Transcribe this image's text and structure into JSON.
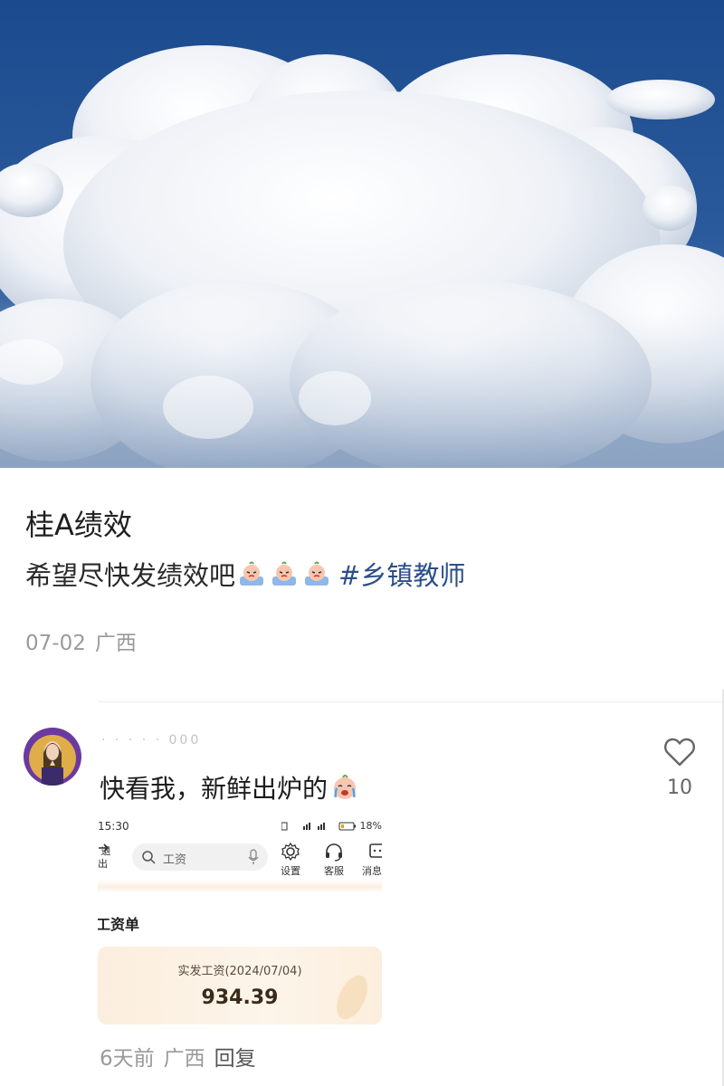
{
  "post": {
    "title": "桂A绩效",
    "body": "希望尽快发绩效吧",
    "hashtag": "#乡镇教师",
    "date": "07-02",
    "location": "广西"
  },
  "comment": {
    "username": "· · · · · 000",
    "text": "快看我，新鲜出炉的",
    "likes": "10",
    "time": "6天前",
    "location": "广西",
    "reply_label": "回复",
    "screenshot": {
      "status_time": "15:30",
      "status_right": "18%",
      "exit_label": "退出",
      "search_placeholder": "工资",
      "settings_label": "设置",
      "service_label": "客服",
      "message_label": "消息",
      "section_title": "工资单",
      "pay_label": "实发工资(2024/07/04)",
      "pay_amount": "934.39"
    }
  },
  "colors": {
    "hashtag": "#2c4f8a",
    "sky": "#21488a",
    "meta": "#9a9a9a"
  },
  "icons": [
    "crying-emoji-icon",
    "heart-icon",
    "search-icon",
    "mic-icon",
    "settings-gear-icon",
    "headset-icon"
  ]
}
